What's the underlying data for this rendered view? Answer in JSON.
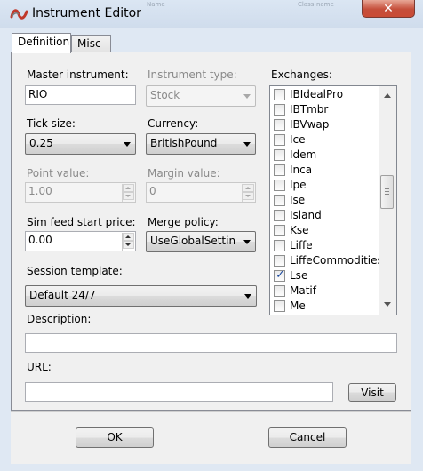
{
  "window": {
    "title": "Instrument Editor",
    "close_label": "✕",
    "background_labels": [
      "Name",
      "Class-name"
    ]
  },
  "tabs": [
    {
      "label": "Definition",
      "active": true
    },
    {
      "label": "Misc",
      "active": false
    }
  ],
  "form": {
    "master_instrument": {
      "label": "Master instrument:",
      "value": "RIO"
    },
    "instrument_type": {
      "label": "Instrument type:",
      "value": "Stock"
    },
    "tick_size": {
      "label": "Tick size:",
      "value": "0.25"
    },
    "currency": {
      "label": "Currency:",
      "value": "BritishPound"
    },
    "point_value": {
      "label": "Point value:",
      "value": "1.00"
    },
    "margin_value": {
      "label": "Margin value:",
      "value": "0"
    },
    "sim_feed_start_price": {
      "label": "Sim feed start price:",
      "value": "0.00"
    },
    "merge_policy": {
      "label": "Merge policy:",
      "value": "UseGlobalSettin"
    },
    "session_template": {
      "label": "Session template:",
      "value": "Default 24/7"
    },
    "description": {
      "label": "Description:",
      "value": ""
    },
    "url": {
      "label": "URL:",
      "value": ""
    },
    "visit_label": "Visit"
  },
  "exchanges": {
    "label": "Exchanges:",
    "items": [
      {
        "name": "IBIdealPro",
        "checked": false
      },
      {
        "name": "IBTmbr",
        "checked": false
      },
      {
        "name": "IBVwap",
        "checked": false
      },
      {
        "name": "Ice",
        "checked": false
      },
      {
        "name": "Idem",
        "checked": false
      },
      {
        "name": "Inca",
        "checked": false
      },
      {
        "name": "Ipe",
        "checked": false
      },
      {
        "name": "Ise",
        "checked": false
      },
      {
        "name": "Island",
        "checked": false
      },
      {
        "name": "Kse",
        "checked": false
      },
      {
        "name": "Liffe",
        "checked": false
      },
      {
        "name": "LiffeCommodities",
        "checked": false
      },
      {
        "name": "Lse",
        "checked": true
      },
      {
        "name": "Matif",
        "checked": false
      },
      {
        "name": "Me",
        "checked": false
      }
    ]
  },
  "buttons": {
    "ok_label": "OK",
    "cancel_label": "Cancel"
  },
  "colors": {
    "brand": "#c0392b",
    "close_button": "#c94b35",
    "check": "#1c4a9e"
  }
}
